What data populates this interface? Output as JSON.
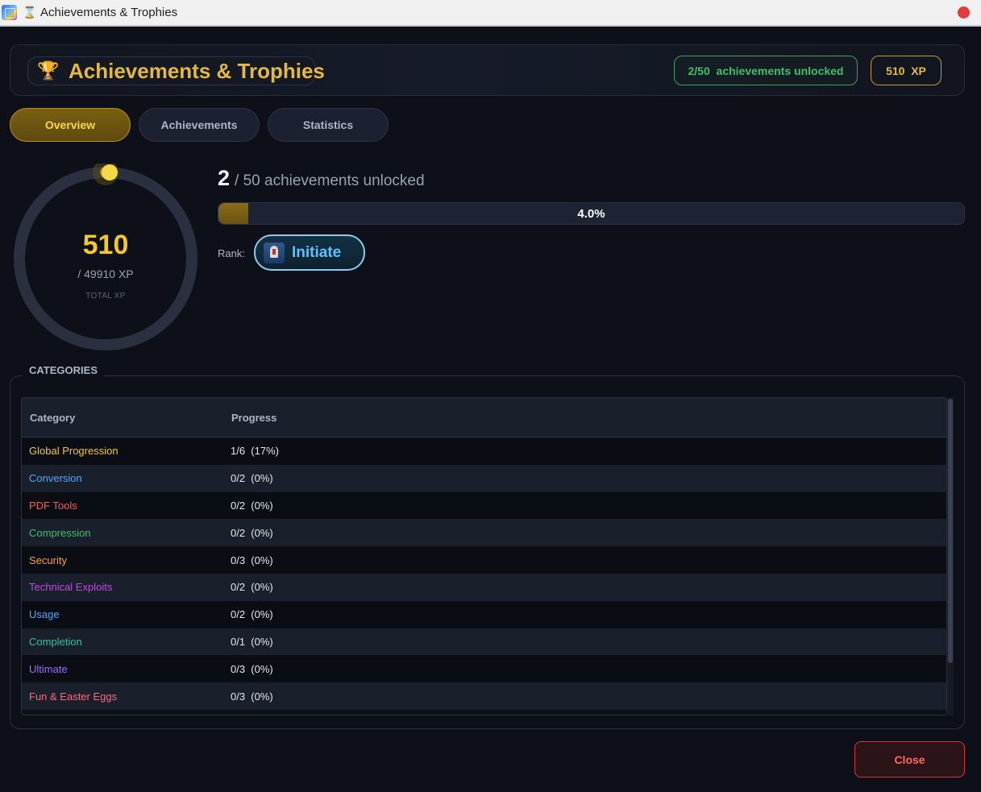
{
  "window": {
    "title": "Achievements & Trophies",
    "app_icon": "app-icon",
    "hourglass_icon": "⌛",
    "close_dot_color": "#e63a3a"
  },
  "header": {
    "trophy_icon": "🏆",
    "title": "Achievements & Trophies",
    "unlocked_badge": "2/50  achievements unlocked",
    "xp_badge": "510  XP"
  },
  "tabs": [
    {
      "label": "Overview",
      "active": true
    },
    {
      "label": "Achievements",
      "active": false
    },
    {
      "label": "Statistics",
      "active": false
    }
  ],
  "xp_ring": {
    "value": "510",
    "total": "/ 49910 XP",
    "caption": "TOTAL XP",
    "fraction": 0.0102,
    "accent": "#f5c825"
  },
  "summary": {
    "unlocked_count": "2",
    "unlocked_text": "/ 50 achievements unlocked",
    "progress_percent": 4.0,
    "progress_label": "4.0%",
    "rank_label": "Rank:",
    "rank_name": "Initiate",
    "rank_icon": "knight-helmet-icon"
  },
  "categories": {
    "title": "CATEGORIES",
    "columns": [
      "Category",
      "Progress"
    ],
    "rows": [
      {
        "name": "Global Progression",
        "progress": "1/6  (17%)",
        "color": "#f5c825"
      },
      {
        "name": "Conversion",
        "progress": "0/2  (0%)",
        "color": "#4aa8ff"
      },
      {
        "name": "PDF Tools",
        "progress": "0/2  (0%)",
        "color": "#ff5a5a"
      },
      {
        "name": "Compression",
        "progress": "0/2  (0%)",
        "color": "#3ec06a"
      },
      {
        "name": "Security",
        "progress": "0/3  (0%)",
        "color": "#ffa12e"
      },
      {
        "name": "Technical Exploits",
        "progress": "0/2  (0%)",
        "color": "#c04ae0"
      },
      {
        "name": "Usage",
        "progress": "0/2  (0%)",
        "color": "#4aa8ff"
      },
      {
        "name": "Completion",
        "progress": "0/1  (0%)",
        "color": "#2ec4a0"
      },
      {
        "name": "Ultimate",
        "progress": "0/3  (0%)",
        "color": "#9a6aff"
      },
      {
        "name": "Fun & Easter Eggs",
        "progress": "0/3  (0%)",
        "color": "#ff6a7a"
      }
    ]
  },
  "footer": {
    "close_label": "Close"
  }
}
